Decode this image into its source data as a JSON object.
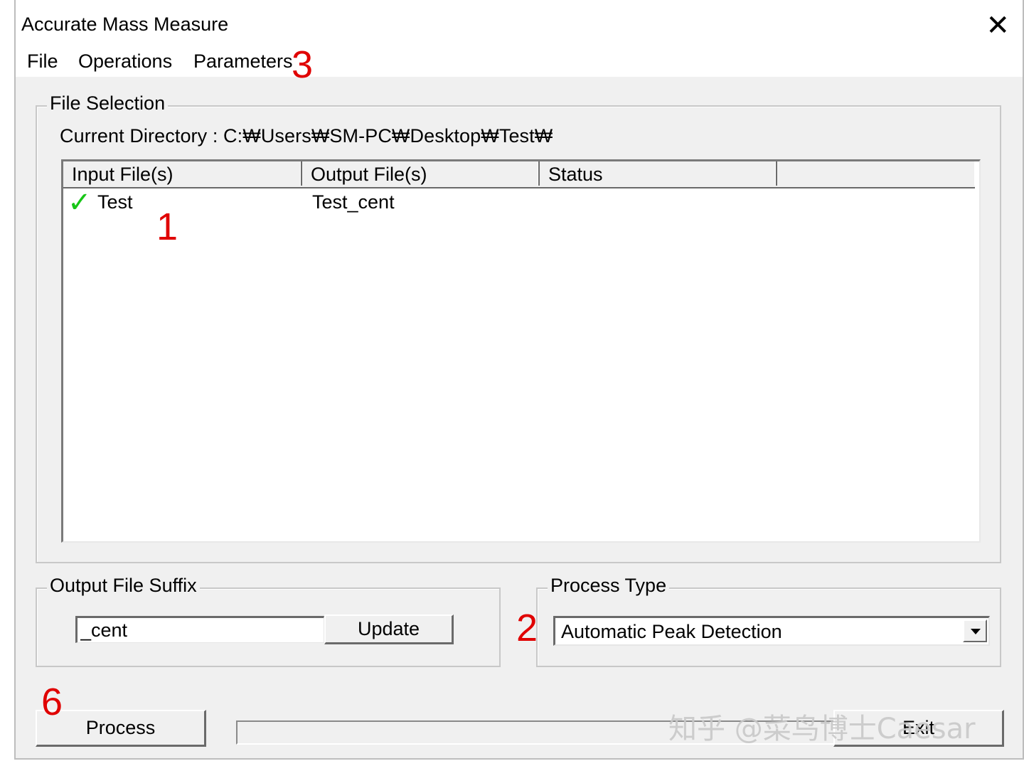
{
  "window": {
    "title": "Accurate Mass Measure",
    "close_glyph": "✕"
  },
  "menu": {
    "items": [
      "File",
      "Operations",
      "Parameters"
    ]
  },
  "markers": [
    "3",
    "1",
    "2",
    "6"
  ],
  "file_selection": {
    "label": "File Selection",
    "current_directory": "Current Directory : C:₩Users₩SM-PC₩Desktop₩Test₩",
    "columns": [
      "Input File(s)",
      "Output File(s)",
      "Status",
      ""
    ],
    "rows": [
      {
        "input": "Test",
        "output": "Test_cent",
        "status": "",
        "check_glyph": "✓"
      }
    ]
  },
  "output_suffix": {
    "label": "Output File Suffix",
    "value": "_cent",
    "update_label": "Update"
  },
  "process_type": {
    "label": "Process Type",
    "selected": "Automatic Peak Detection"
  },
  "actions": {
    "process_label": "Process",
    "exit_label": "Exit"
  },
  "progress": {
    "value": 0
  },
  "watermark": {
    "text": "知乎 @菜鸟博士Caesar"
  },
  "colors": {
    "marker": "#e00000",
    "check": "#17c617",
    "dialog_bg": "#f0f0f0"
  }
}
